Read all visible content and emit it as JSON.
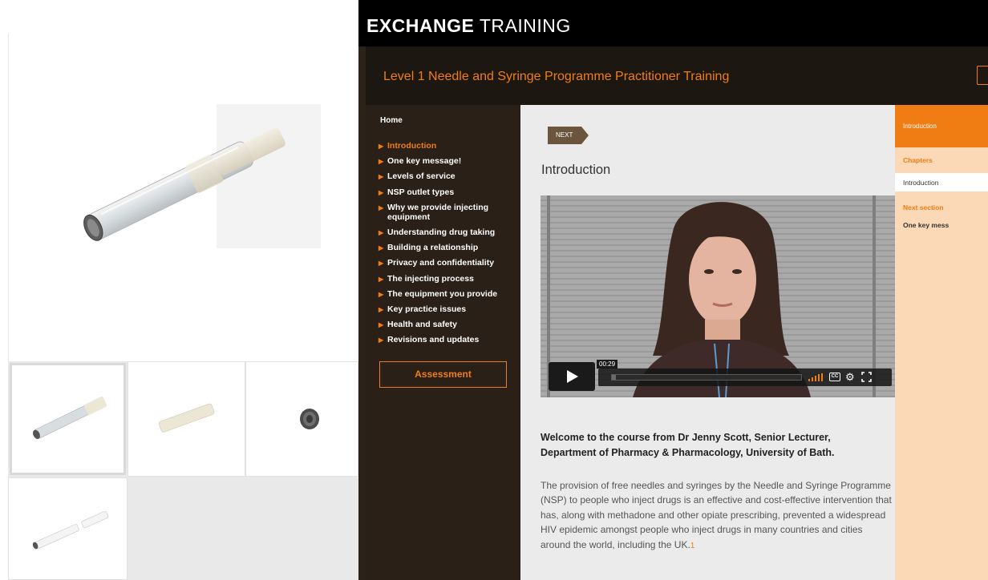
{
  "brand": {
    "bold": "EXCHANGE",
    "light": "TRAINING"
  },
  "course": {
    "title": "Level 1 Needle and Syringe Programme Practitioner Training"
  },
  "nav": {
    "home": "Home",
    "items": [
      {
        "label": "Introduction",
        "active": true
      },
      {
        "label": "One key message!"
      },
      {
        "label": "Levels of service"
      },
      {
        "label": "NSP outlet types"
      },
      {
        "label": "Why we provide injecting equipment"
      },
      {
        "label": "Understanding drug taking"
      },
      {
        "label": "Building a relationship"
      },
      {
        "label": "Privacy and confidentiality"
      },
      {
        "label": "The injecting process"
      },
      {
        "label": "The equipment you provide"
      },
      {
        "label": "Key practice issues"
      },
      {
        "label": "Health and safety"
      },
      {
        "label": "Revisions and updates"
      }
    ],
    "assessment": "Assessment"
  },
  "content": {
    "next_label": "NEXT",
    "section_title": "Introduction",
    "video": {
      "time": "00:29",
      "progress": 0.02,
      "cc": "CC"
    },
    "welcome": "Welcome to the course from Dr Jenny Scott, Senior Lecturer, Department of Pharmacy & Pharmacology, University of Bath.",
    "body": "The provision of free needles and syringes by the Needle and Syringe Programme (NSP) to people who inject drugs is an effective and cost-effective intervention that has, along with methadone and other opiate prescribing, prevented a widespread HIV epidemic amongst people who inject drugs in many countries and cities around the world, including the UK.",
    "footnote": "1"
  },
  "side": {
    "header": "Introduction",
    "chapters_label": "Chapters",
    "current_chapter": "Introduction",
    "next_section_label": "Next section",
    "next_section": "One key mess"
  },
  "colors": {
    "accent": "#f07d13",
    "nav_bg": "#2a2017",
    "side_bg": "#fbd8b6"
  }
}
